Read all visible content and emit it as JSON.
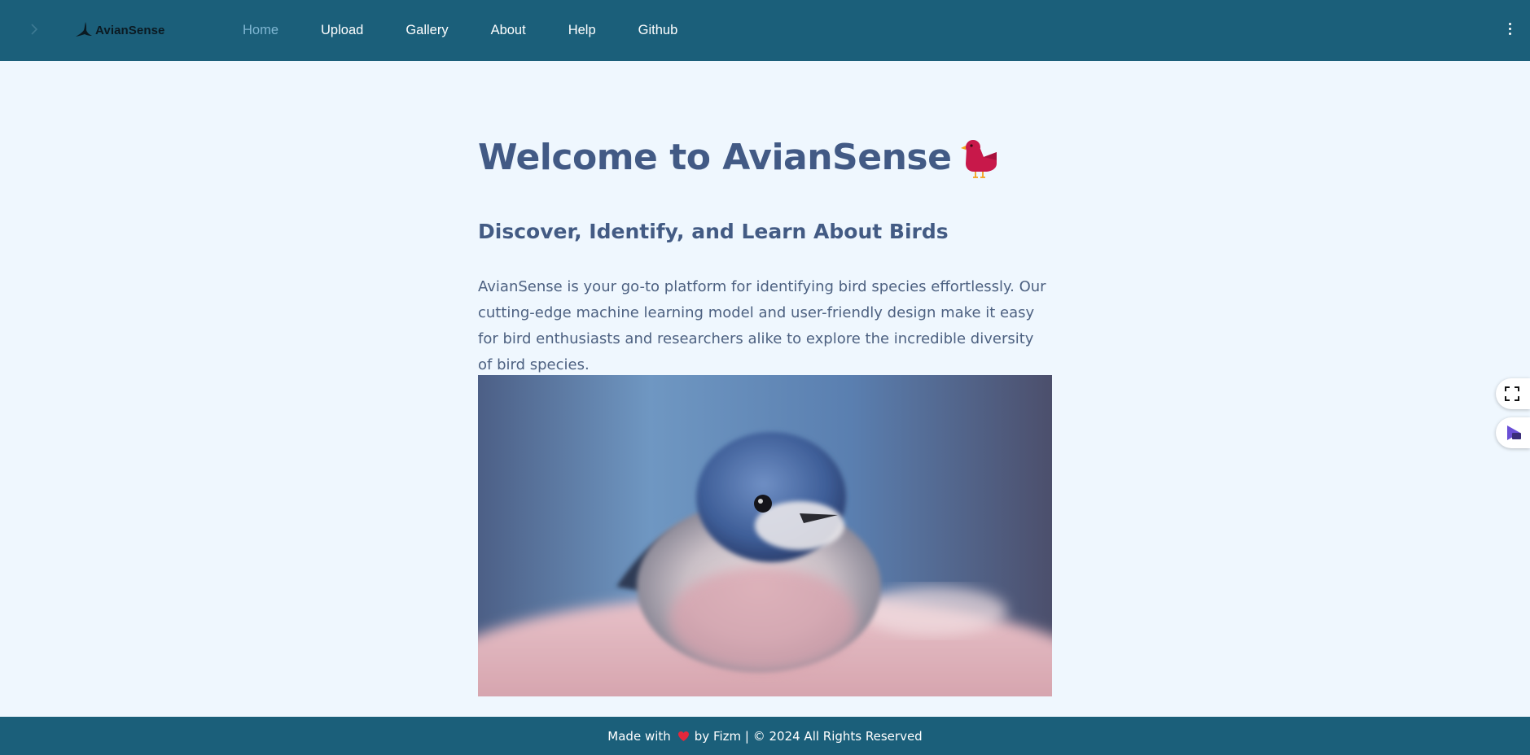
{
  "app": {
    "brand": "AvianSense"
  },
  "nav": {
    "items": [
      {
        "label": "Home",
        "active": true
      },
      {
        "label": "Upload",
        "active": false
      },
      {
        "label": "Gallery",
        "active": false
      },
      {
        "label": "About",
        "active": false
      },
      {
        "label": "Help",
        "active": false
      },
      {
        "label": "Github",
        "active": false
      }
    ]
  },
  "main": {
    "title": "Welcome to AvianSense",
    "title_emoji": "bird-icon",
    "subtitle": "Discover, Identify, and Learn About Birds",
    "intro": "AvianSense is your go-to platform for identifying bird species effortlessly. Our cutting-edge machine learning model and user-friendly design make it easy for bird enthusiasts and researchers alike to explore the incredible diversity of bird species.",
    "hero_image": "bird-photo"
  },
  "footer": {
    "made_with": "Made with",
    "by_text": "by Fizm | © 2024 All Rights Reserved"
  },
  "colors": {
    "nav_bg": "#1b5f7a",
    "page_bg": "#eff7fe",
    "heading": "#425a85",
    "active_link": "#7fb6d2"
  }
}
